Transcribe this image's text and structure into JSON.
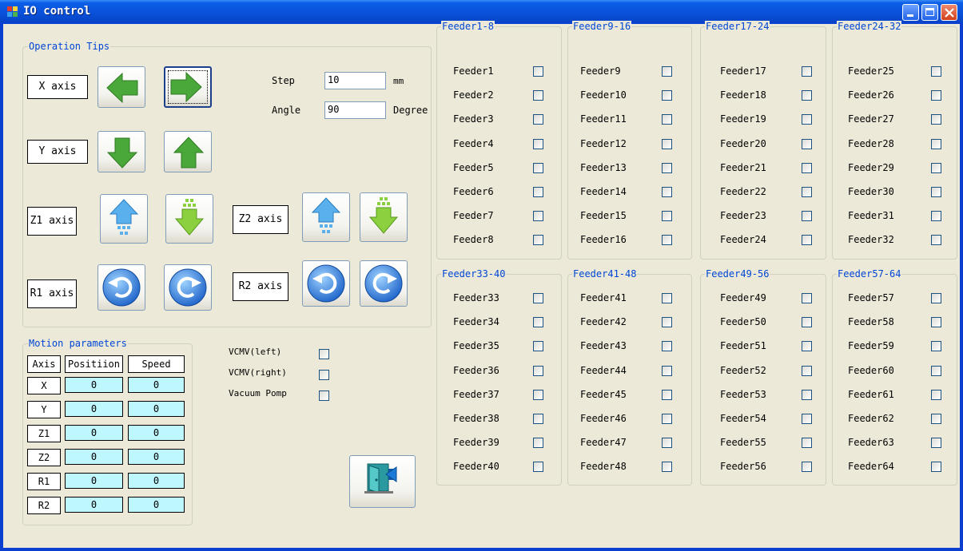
{
  "window": {
    "title": "IO control"
  },
  "operation": {
    "title": "Operation Tips",
    "axes": [
      "X axis",
      "Y axis",
      "Z1 axis",
      "R1 axis"
    ],
    "z2_label": "Z2 axis",
    "r2_label": "R2 axis",
    "step_label": "Step",
    "step_value": "10",
    "step_unit": "mm",
    "angle_label": "Angle",
    "angle_value": "90",
    "angle_unit": "Degree"
  },
  "motion": {
    "title": "Motion parameters",
    "headers": [
      "Axis",
      "Positiion",
      "Speed"
    ],
    "rows": [
      {
        "axis": "X",
        "position": "0",
        "speed": "0"
      },
      {
        "axis": "Y",
        "position": "0",
        "speed": "0"
      },
      {
        "axis": "Z1",
        "position": "0",
        "speed": "0"
      },
      {
        "axis": "Z2",
        "position": "0",
        "speed": "0"
      },
      {
        "axis": "R1",
        "position": "0",
        "speed": "0"
      },
      {
        "axis": "R2",
        "position": "0",
        "speed": "0"
      }
    ]
  },
  "switches": [
    {
      "label": "VCMV(left)",
      "checked": false
    },
    {
      "label": "VCMV(right)",
      "checked": false
    },
    {
      "label": "Vacuum Pomp",
      "checked": false
    }
  ],
  "feeder_groups": [
    {
      "title": "Feeder1-8",
      "items": [
        "Feeder1",
        "Feeder2",
        "Feeder3",
        "Feeder4",
        "Feeder5",
        "Feeder6",
        "Feeder7",
        "Feeder8"
      ]
    },
    {
      "title": "Feeder9-16",
      "items": [
        "Feeder9",
        "Feeder10",
        "Feeder11",
        "Feeder12",
        "Feeder13",
        "Feeder14",
        "Feeder15",
        "Feeder16"
      ]
    },
    {
      "title": "Feeder17-24",
      "items": [
        "Feeder17",
        "Feeder18",
        "Feeder19",
        "Feeder20",
        "Feeder21",
        "Feeder22",
        "Feeder23",
        "Feeder24"
      ]
    },
    {
      "title": "Feeder24-32",
      "items": [
        "Feeder25",
        "Feeder26",
        "Feeder27",
        "Feeder28",
        "Feeder29",
        "Feeder30",
        "Feeder31",
        "Feeder32"
      ]
    },
    {
      "title": "Feeder33-40",
      "items": [
        "Feeder33",
        "Feeder34",
        "Feeder35",
        "Feeder36",
        "Feeder37",
        "Feeder38",
        "Feeder39",
        "Feeder40"
      ]
    },
    {
      "title": "Feeder41-48",
      "items": [
        "Feeder41",
        "Feeder42",
        "Feeder43",
        "Feeder44",
        "Feeder45",
        "Feeder46",
        "Feeder47",
        "Feeder48"
      ]
    },
    {
      "title": "Feeder49-56",
      "items": [
        "Feeder49",
        "Feeder50",
        "Feeder51",
        "Feeder52",
        "Feeder53",
        "Feeder54",
        "Feeder55",
        "Feeder56"
      ]
    },
    {
      "title": "Feeder57-64",
      "items": [
        "Feeder57",
        "Feeder58",
        "Feeder59",
        "Feeder60",
        "Feeder61",
        "Feeder62",
        "Feeder63",
        "Feeder64"
      ]
    }
  ],
  "colors": {
    "title_blue": "#0a52dc",
    "group_title": "#0046d5",
    "value_cell": "#bff7ff",
    "arrow_green": "#4aa83a"
  }
}
